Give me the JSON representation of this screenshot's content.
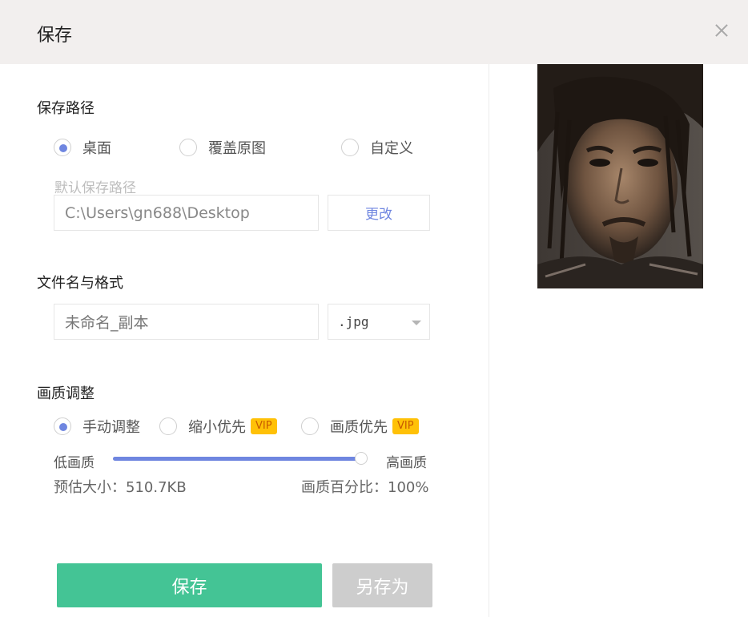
{
  "dialog": {
    "title": "保存"
  },
  "save_path": {
    "title": "保存路径",
    "options": [
      "桌面",
      "覆盖原图",
      "自定义"
    ],
    "selected": 0,
    "hint": "默认保存路径",
    "path_value": "C:\\Users\\gn688\\Desktop",
    "change_label": "更改"
  },
  "file": {
    "title": "文件名与格式",
    "name_value": "未命名_副本",
    "format_value": ".jpg"
  },
  "quality": {
    "title": "画质调整",
    "options": [
      "手动调整",
      "缩小优先",
      "画质优先"
    ],
    "selected": 0,
    "vip_label": "VIP",
    "low_label": "低画质",
    "high_label": "高画质",
    "slider_percent": 100,
    "estimated_size_label": "预估大小：",
    "estimated_size_value": "510.7KB",
    "percent_label": "画质百分比：",
    "percent_value": "100%"
  },
  "actions": {
    "save_label": "保存",
    "save_as_label": "另存为"
  },
  "colors": {
    "accent": "#6f86e0",
    "save_button": "#44c495",
    "vip_badge": "#ffc107",
    "disabled": "#cdcdcd"
  }
}
